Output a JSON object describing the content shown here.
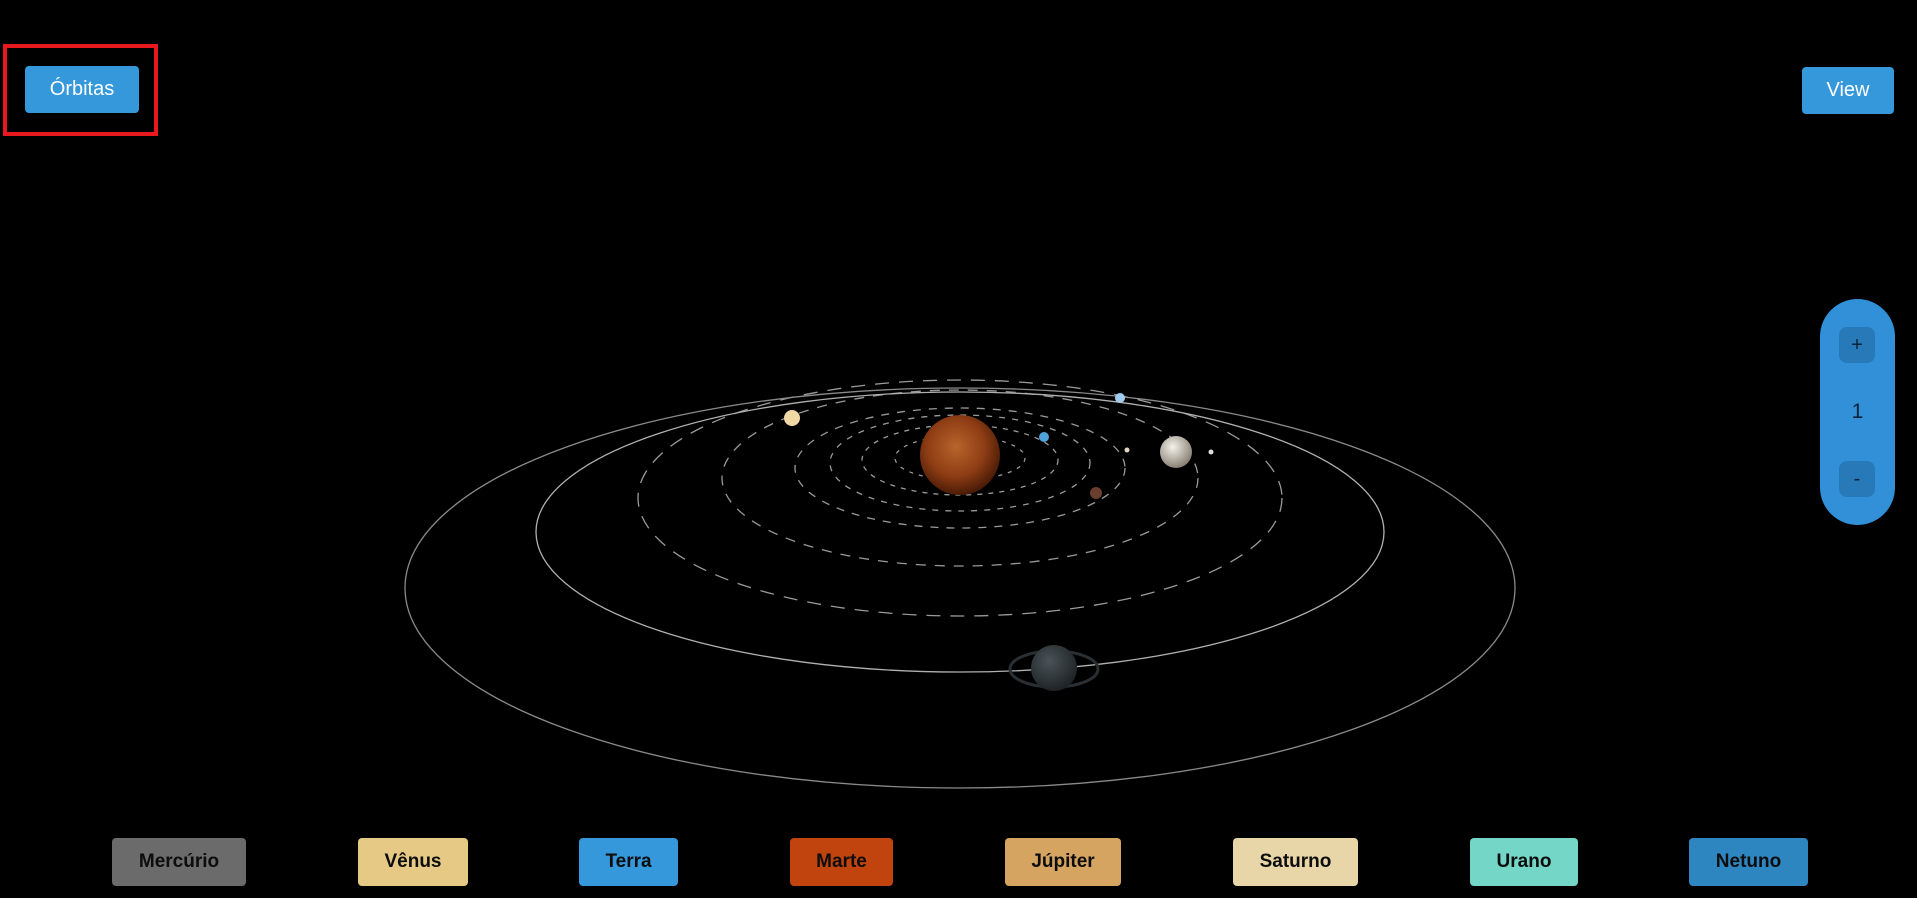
{
  "controls": {
    "orbits_label": "Órbitas",
    "view_label": "View",
    "zoom_in_label": "+",
    "zoom_out_label": "-",
    "zoom_level": "1"
  },
  "planets": [
    {
      "label": "Mercúrio",
      "color": "#6b6b6b"
    },
    {
      "label": "Vênus",
      "color": "#e6c984"
    },
    {
      "label": "Terra",
      "color": "#3498db"
    },
    {
      "label": "Marte",
      "color": "#c1440e"
    },
    {
      "label": "Júpiter",
      "color": "#d4a460"
    },
    {
      "label": "Saturno",
      "color": "#e8d5a8"
    },
    {
      "label": "Urano",
      "color": "#74d6c6"
    },
    {
      "label": "Netuno",
      "color": "#2e86c1"
    }
  ],
  "scene": {
    "background": "#000000",
    "highlight_color": "#e8191e",
    "sun_color": "#a8461a"
  }
}
